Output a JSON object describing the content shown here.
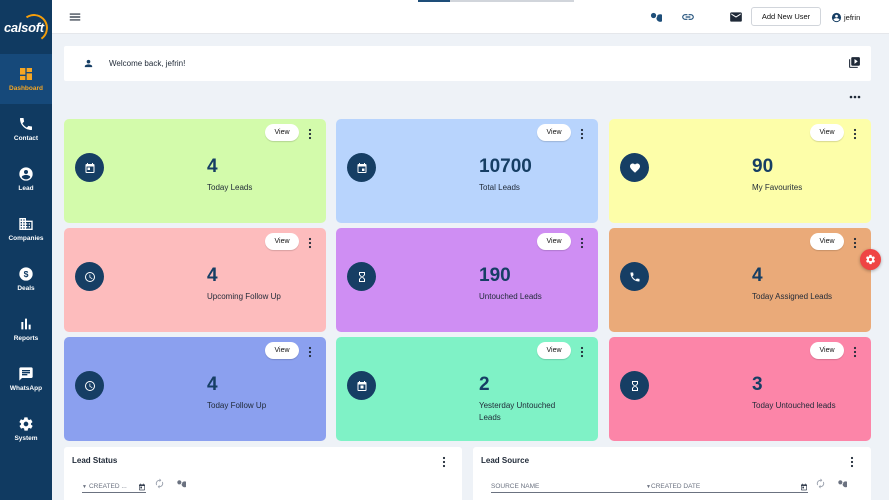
{
  "brand": {
    "name": "calsoft"
  },
  "sidebar": {
    "items": [
      {
        "label": "Dashboard",
        "icon": "dashboard-icon",
        "active": true
      },
      {
        "label": "Contact",
        "icon": "phone-icon"
      },
      {
        "label": "Lead",
        "icon": "person-icon"
      },
      {
        "label": "Companies",
        "icon": "building-icon"
      },
      {
        "label": "Deals",
        "icon": "dollar-icon"
      },
      {
        "label": "Reports",
        "icon": "bar-chart-icon"
      },
      {
        "label": "WhatsApp",
        "icon": "chat-icon"
      },
      {
        "label": "System",
        "icon": "gear-icon"
      }
    ]
  },
  "header": {
    "add_user_label": "Add New User",
    "user_name": "jefrin"
  },
  "welcome": {
    "text": "Welcome back, jefrin!"
  },
  "cards": [
    {
      "value": "4",
      "label": "Today Leads",
      "view": "View",
      "bg": "#d3fbab",
      "icon": "calendar-icon"
    },
    {
      "value": "10700",
      "label": "Total Leads",
      "view": "View",
      "bg": "#b8d4fd",
      "icon": "calendar-icon"
    },
    {
      "value": "90",
      "label": "My Favourites",
      "view": "View",
      "bg": "#fdfea9",
      "icon": "heart-icon"
    },
    {
      "value": "4",
      "label": "Upcoming Follow Up",
      "view": "View",
      "bg": "#fdbcbd",
      "icon": "clock-icon"
    },
    {
      "value": "190",
      "label": "Untouched Leads",
      "view": "View",
      "bg": "#cf8ef3",
      "icon": "hourglass-icon"
    },
    {
      "value": "4",
      "label": "Today Assigned Leads",
      "view": "View",
      "bg": "#eaaa79",
      "icon": "phone-icon"
    },
    {
      "value": "4",
      "label": "Today Follow Up",
      "view": "View",
      "bg": "#8ba0ef",
      "icon": "clock-icon"
    },
    {
      "value": "2",
      "label": "Yesterday Untouched Leads",
      "view": "View",
      "bg": "#7ff2c6",
      "icon": "calendar-icon"
    },
    {
      "value": "3",
      "label": "Today Untouched leads",
      "view": "View",
      "bg": "#fc85a8",
      "icon": "hourglass-icon"
    }
  ],
  "lead_status": {
    "title": "Lead Status",
    "date_field": "CREATED ..."
  },
  "lead_source": {
    "title": "Lead Source",
    "source_field": "SOURCE NAME",
    "date_field": "CREATED DATE"
  },
  "colors": {
    "sidebar": "#103a61",
    "accent": "#f5a623",
    "icon_circle": "#163e64",
    "fab": "#ef4444"
  }
}
